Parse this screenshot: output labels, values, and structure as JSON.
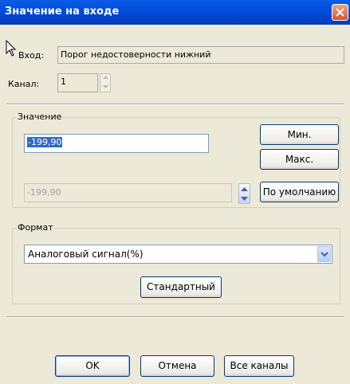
{
  "window": {
    "title": "Значение на входе"
  },
  "input_row": {
    "label": "Вход:",
    "value": "Порог недостоверности нижний"
  },
  "channel_row": {
    "label": "Канал:",
    "value": "1"
  },
  "value_group": {
    "legend": "Значение",
    "current_value": "-199,90",
    "default_value": "-199,90",
    "min_label": "Мин.",
    "max_label": "Макс.",
    "default_label": "По умолчанию"
  },
  "format_group": {
    "legend": "Формат",
    "selected_format": "Аналоговый сигнал(%)",
    "standard_label": "Стандартный"
  },
  "footer": {
    "ok_label": "OK",
    "cancel_label": "Отмена",
    "all_channels_label": "Все каналы"
  },
  "colors": {
    "titlebar": "#0a5ce6",
    "face": "#ece9d8",
    "selection": "#316ac5",
    "close": "#d9532c"
  },
  "icons": [
    "close-icon",
    "mouse-cursor-icon",
    "spin-up-icon",
    "spin-down-icon",
    "dropdown-arrow-icon"
  ]
}
